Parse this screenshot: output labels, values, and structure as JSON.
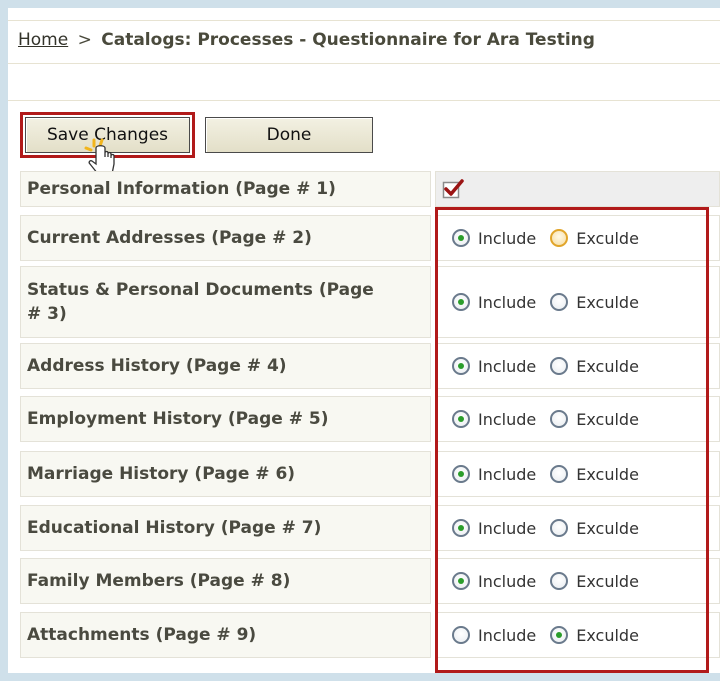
{
  "breadcrumb": {
    "home": "Home",
    "separator": ">",
    "title": "Catalogs: Processes - Questionnaire for Ara Testing"
  },
  "toolbar": {
    "save_label": "Save Changes",
    "done_label": "Done"
  },
  "options": {
    "include_label": "Include",
    "exclude_label": "Exculde"
  },
  "rows": [
    {
      "label": "Personal Information (Page # 1)",
      "checked": true
    },
    {
      "label": "Current Addresses (Page # 2)",
      "selected": "include"
    },
    {
      "label": "Status & Personal Documents (Page # 3)",
      "selected": "include"
    },
    {
      "label": "Address History (Page # 4)",
      "selected": "include"
    },
    {
      "label": "Employment History (Page # 5)",
      "selected": "include"
    },
    {
      "label": "Marriage History (Page # 6)",
      "selected": "include"
    },
    {
      "label": "Educational History (Page # 7)",
      "selected": "include"
    },
    {
      "label": "Family Members (Page # 8)",
      "selected": "include"
    },
    {
      "label": "Attachments (Page # 9)",
      "selected": "exclude"
    }
  ],
  "colors": {
    "highlight": "#b11a1a",
    "radio_selected": "#2b9d2b"
  }
}
